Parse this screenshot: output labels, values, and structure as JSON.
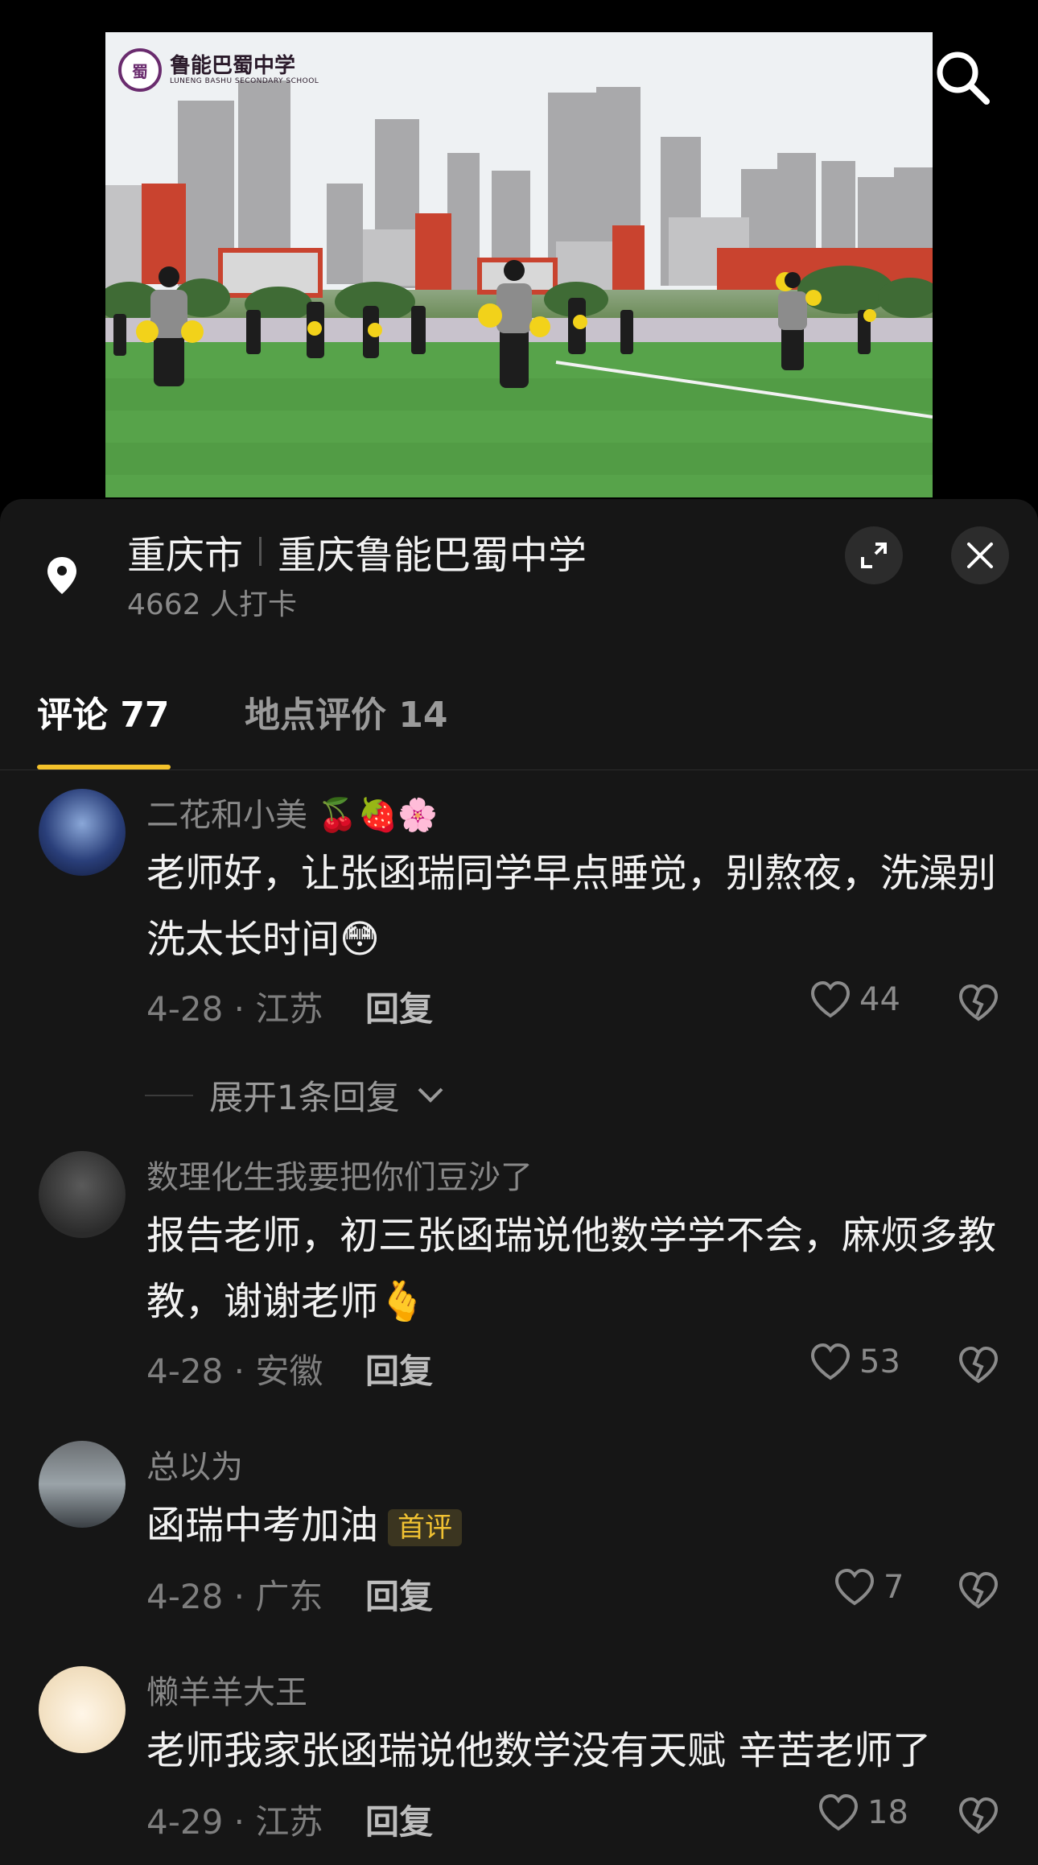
{
  "video": {
    "logo_text": "鲁能巴蜀中学",
    "logo_subtitle": "LUNENG BASHU SECONDARY SCHOOL",
    "search_icon": "search-icon"
  },
  "location": {
    "city": "重庆市",
    "place": "重庆鲁能巴蜀中学",
    "checkins": "4662 人打卡",
    "icons": [
      "location-pin-icon",
      "expand-icon",
      "close-icon"
    ]
  },
  "tabs": [
    {
      "label": "评论 77",
      "active": true
    },
    {
      "label": "地点评价 14",
      "active": false
    }
  ],
  "colors": {
    "accent": "#f4c22b",
    "background": "#161616"
  },
  "comments": [
    {
      "name": "二花和小美",
      "name_emoji": "🍒🍓🌸",
      "text": "老师好，让张函瑞同学早点睡觉，别熬夜，洗澡别洗太长时间",
      "text_emoji": "😳",
      "date_loc": "4-28 · 江苏",
      "reply": "回复",
      "likes": "44"
    },
    {
      "name": "数理化生我要把你们豆沙了",
      "text": "报告老师，初三张函瑞说他数学学不会，麻烦多教教，谢谢老师",
      "text_emoji": "🫰",
      "date_loc": "4-28 · 安徽",
      "reply": "回复",
      "likes": "53"
    },
    {
      "name": "总以为",
      "text": "函瑞中考加油",
      "badge": "首评",
      "date_loc": "4-28 · 广东",
      "reply": "回复",
      "likes": "7"
    },
    {
      "name": "懒羊羊大王",
      "text": "老师我家张函瑞说他数学没有天赋 辛苦老师了",
      "date_loc": "4-29 · 江苏",
      "reply": "回复",
      "likes": "18"
    }
  ],
  "expand_replies": "展开1条回复"
}
